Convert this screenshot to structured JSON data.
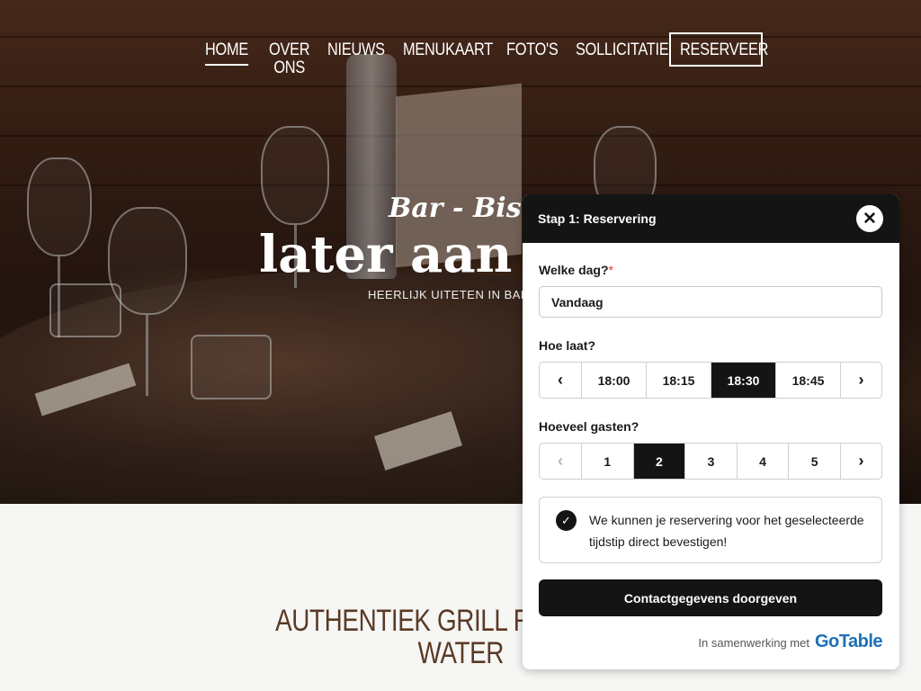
{
  "nav": {
    "items": [
      {
        "label": "HOME"
      },
      {
        "label": "OVER"
      },
      {
        "label": "ONS"
      },
      {
        "label": "NIEUWS"
      },
      {
        "label": "MENUKAART"
      },
      {
        "label": "FOTO'S"
      },
      {
        "label": "SOLLICITATIE"
      },
      {
        "label": "RESERVEER"
      }
    ]
  },
  "hero": {
    "tagline": "Bar - Bistr",
    "title": "later aan 't",
    "subtitle": "HEERLIJK UITETEN IN BADHOEV"
  },
  "headline": {
    "line1": "AUTHENTIEK GRILL RESTAURA",
    "line2": "WATER"
  },
  "widget": {
    "step_title": "Stap 1: Reservering",
    "close_glyph": "✕",
    "day_label": "Welke dag?",
    "required_mark": "*",
    "day_value": "Vandaag",
    "time_label": "Hoe laat?",
    "times": [
      "18:00",
      "18:15",
      "18:30",
      "18:45"
    ],
    "selected_time": "18:30",
    "guests_label": "Hoeveel gasten?",
    "guests": [
      "1",
      "2",
      "3",
      "4",
      "5"
    ],
    "selected_guests": "2",
    "arrow_left": "‹",
    "arrow_right": "›",
    "notice_text": "We kunnen je reservering voor het geselecteerde tijdstip direct bevestigen!",
    "check_glyph": "✓",
    "button_label": "Contactgegevens doorgeven",
    "powered_by": "In samenwerking met",
    "brand": "GoTable"
  },
  "colors": {
    "dark": "#141414",
    "brand_blue": "#1d6fb8",
    "headline_brown": "#5a3a26",
    "required_red": "#d33333"
  }
}
